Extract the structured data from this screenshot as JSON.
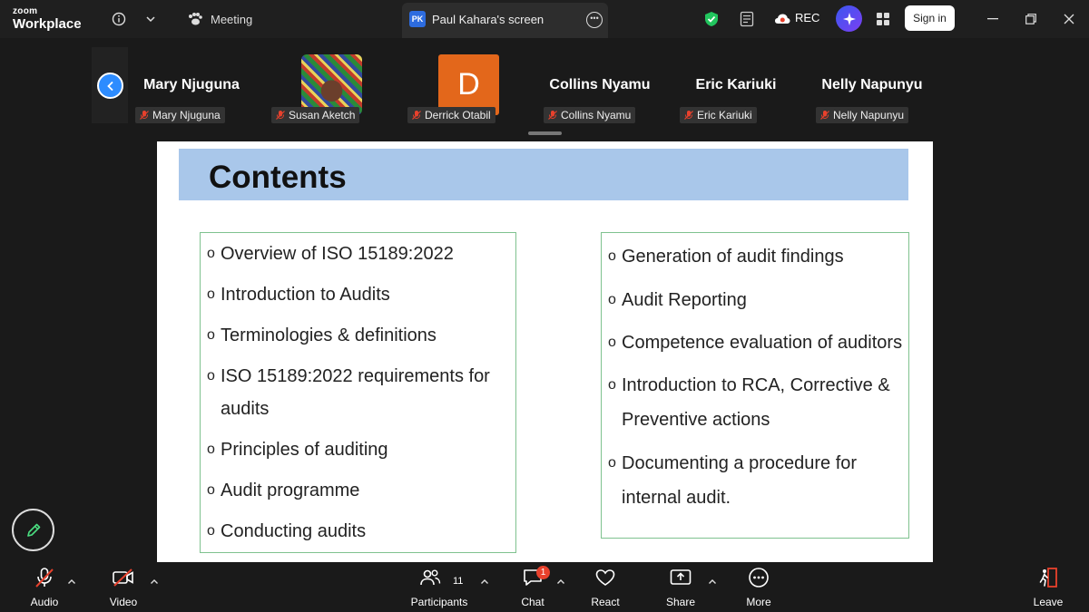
{
  "app": {
    "logo_top": "zoom",
    "logo_bottom": "Workplace"
  },
  "titlebar": {
    "meeting_label": "Meeting",
    "screen_tab": {
      "initials": "PK",
      "label": "Paul Kahara's screen"
    },
    "rec_label": "REC",
    "signin_label": "Sign in"
  },
  "participants": [
    {
      "name": "Mary Njuguna",
      "tag": "Mary Njuguna",
      "display": "name"
    },
    {
      "name": "Susan Aketch",
      "tag": "Susan Aketch",
      "display": "photo"
    },
    {
      "name": "Derrick Otabil",
      "tag": "Derrick Otabil",
      "display": "initial",
      "initial": "D"
    },
    {
      "name": "Collins Nyamu",
      "tag": "Collins Nyamu",
      "display": "name"
    },
    {
      "name": "Eric Kariuki",
      "tag": "Eric Kariuki",
      "display": "name"
    },
    {
      "name": "Nelly Napunyu",
      "tag": "Nelly Napunyu",
      "display": "name"
    }
  ],
  "slide": {
    "title": "Contents",
    "bullet": "o",
    "left_items": [
      [
        "Overview of ISO 15189:2022"
      ],
      [
        "Introduction to Audits"
      ],
      [
        "Terminologies & definitions"
      ],
      [
        "ISO 15189:2022 requirements for",
        "audits"
      ],
      [
        "Principles of auditing"
      ],
      [
        "Audit programme"
      ],
      [
        "Conducting audits"
      ]
    ],
    "right_items": [
      [
        "Generation of audit findings"
      ],
      [
        "Audit Reporting"
      ],
      [
        "Competence evaluation of auditors"
      ],
      [
        "Introduction to RCA, Corrective &",
        "Preventive actions"
      ],
      [
        "Documenting a procedure for",
        "internal audit."
      ]
    ]
  },
  "toolbar": {
    "audio": "Audio",
    "video": "Video",
    "participants": "Participants",
    "participants_count": "11",
    "chat": "Chat",
    "chat_badge": "1",
    "react": "React",
    "share": "Share",
    "more": "More",
    "leave": "Leave"
  },
  "colors": {
    "accent_blue": "#2d8cff",
    "leave_red": "#e8412c",
    "slide_title_bg": "#a9c7ea",
    "box_border": "#7fc28f",
    "shield_green": "#22c55e"
  }
}
